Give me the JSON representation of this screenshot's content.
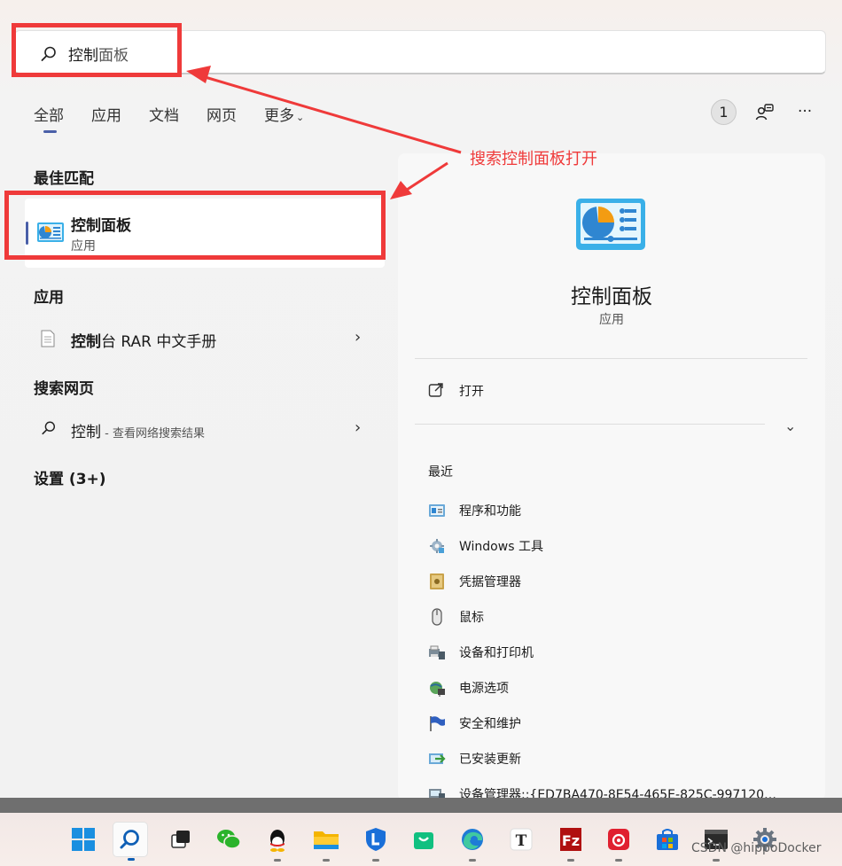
{
  "search": {
    "typed": "控制",
    "rest": "面板"
  },
  "tabs": [
    {
      "label": "全部",
      "active": true
    },
    {
      "label": "应用"
    },
    {
      "label": "文档"
    },
    {
      "label": "网页"
    },
    {
      "label": "更多",
      "chevron": "⌄"
    }
  ],
  "toolbar": {
    "badge_count": "1",
    "more": "···"
  },
  "best_match": {
    "heading": "最佳匹配",
    "name": "控制面板",
    "type": "应用"
  },
  "apps": {
    "heading": "应用",
    "item_bold": "控制",
    "item_rest": "台 RAR 中文手册"
  },
  "web": {
    "heading": "搜索网页",
    "item": "控制",
    "hint": " - 查看网络搜索结果"
  },
  "settings": {
    "heading": "设置 (3+)"
  },
  "detail": {
    "title": "控制面板",
    "subtitle": "应用",
    "open_label": "打开",
    "recent_heading": "最近",
    "recent": [
      {
        "label": "程序和功能",
        "icon": "programs-icon"
      },
      {
        "label": "Windows 工具",
        "icon": "tools-icon"
      },
      {
        "label": "凭据管理器",
        "icon": "credential-icon"
      },
      {
        "label": "鼠标",
        "icon": "mouse-icon"
      },
      {
        "label": "设备和打印机",
        "icon": "printer-icon"
      },
      {
        "label": "电源选项",
        "icon": "power-icon"
      },
      {
        "label": "安全和维护",
        "icon": "flag-icon"
      },
      {
        "label": "已安装更新",
        "icon": "update-icon"
      },
      {
        "label": "设备管理器::{ED7BA470-8E54-465E-825C-997120…",
        "icon": "device-manager-icon"
      }
    ]
  },
  "annotation": {
    "text": "搜索控制面板打开",
    "color": "#ef3a3a"
  },
  "taskbar": {
    "apps": [
      "start",
      "search",
      "task-view",
      "wechat",
      "qq",
      "file-explorer",
      "lenovo",
      "store-bag",
      "edge",
      "typora",
      "filezilla",
      "netease-music",
      "microsoft-store",
      "terminal",
      "settings"
    ]
  },
  "watermark": "CSDN @hippoDocker"
}
